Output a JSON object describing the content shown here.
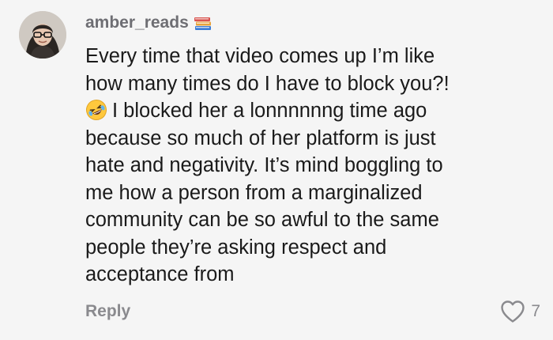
{
  "comment": {
    "username": "amber_reads",
    "username_badge_icon": "books-icon",
    "lines": [
      "Every time that video comes up I’m like",
      "how many times do I have to block you?!",
      "I blocked her a lonnnnnng time ago",
      "because so much of her platform is just",
      "hate and negativity. It’s mind boggling to",
      "me how a person from a marginalized",
      "community can be so awful to the same",
      "people they’re asking respect and",
      "acceptance from"
    ],
    "inline_emoji_icon": "rolling-laughing-face-icon",
    "reply_label": "Reply",
    "like_icon": "heart-outline-icon",
    "like_count": "7"
  },
  "colors": {
    "background": "#f5f5f5",
    "text": "#1a1a1a",
    "muted": "#8a8a8e"
  }
}
